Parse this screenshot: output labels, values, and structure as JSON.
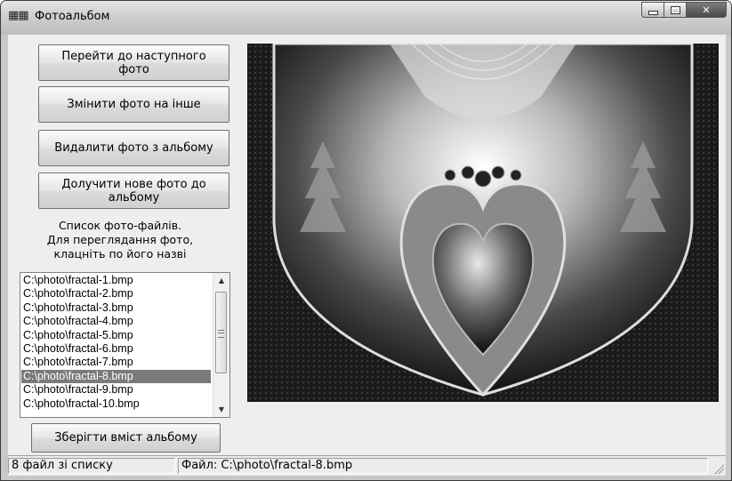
{
  "window": {
    "title": "Фотоальбом",
    "icon_text": "XX"
  },
  "buttons": {
    "next": "Перейти до наступного фото",
    "change": "Змінити фото на інше",
    "delete": "Видалити фото з альбому",
    "add": "Долучити нове фото до альбому",
    "save": "Зберігти  вміст  альбому"
  },
  "caption": {
    "line1": "Список фото-файлів.",
    "line2": "Для переглядання фото,",
    "line3": "клацніть по його назві"
  },
  "files": [
    "C:\\photo\\fractal-1.bmp",
    "C:\\photo\\fractal-2.bmp",
    "C:\\photo\\fractal-3.bmp",
    "C:\\photo\\fractal-4.bmp",
    "C:\\photo\\fractal-5.bmp",
    "C:\\photo\\fractal-6.bmp",
    "C:\\photo\\fractal-7.bmp",
    "C:\\photo\\fractal-8.bmp",
    "C:\\photo\\fractal-9.bmp",
    "C:\\photo\\fractal-10.bmp"
  ],
  "selected_file_index": 7,
  "status": {
    "count": "8  файл зі списку",
    "file": "Файл: C:\\photo\\fractal-8.bmp"
  },
  "icons": {
    "minimize": "minimize-icon",
    "maximize": "maximize-icon",
    "close": "close-icon"
  }
}
